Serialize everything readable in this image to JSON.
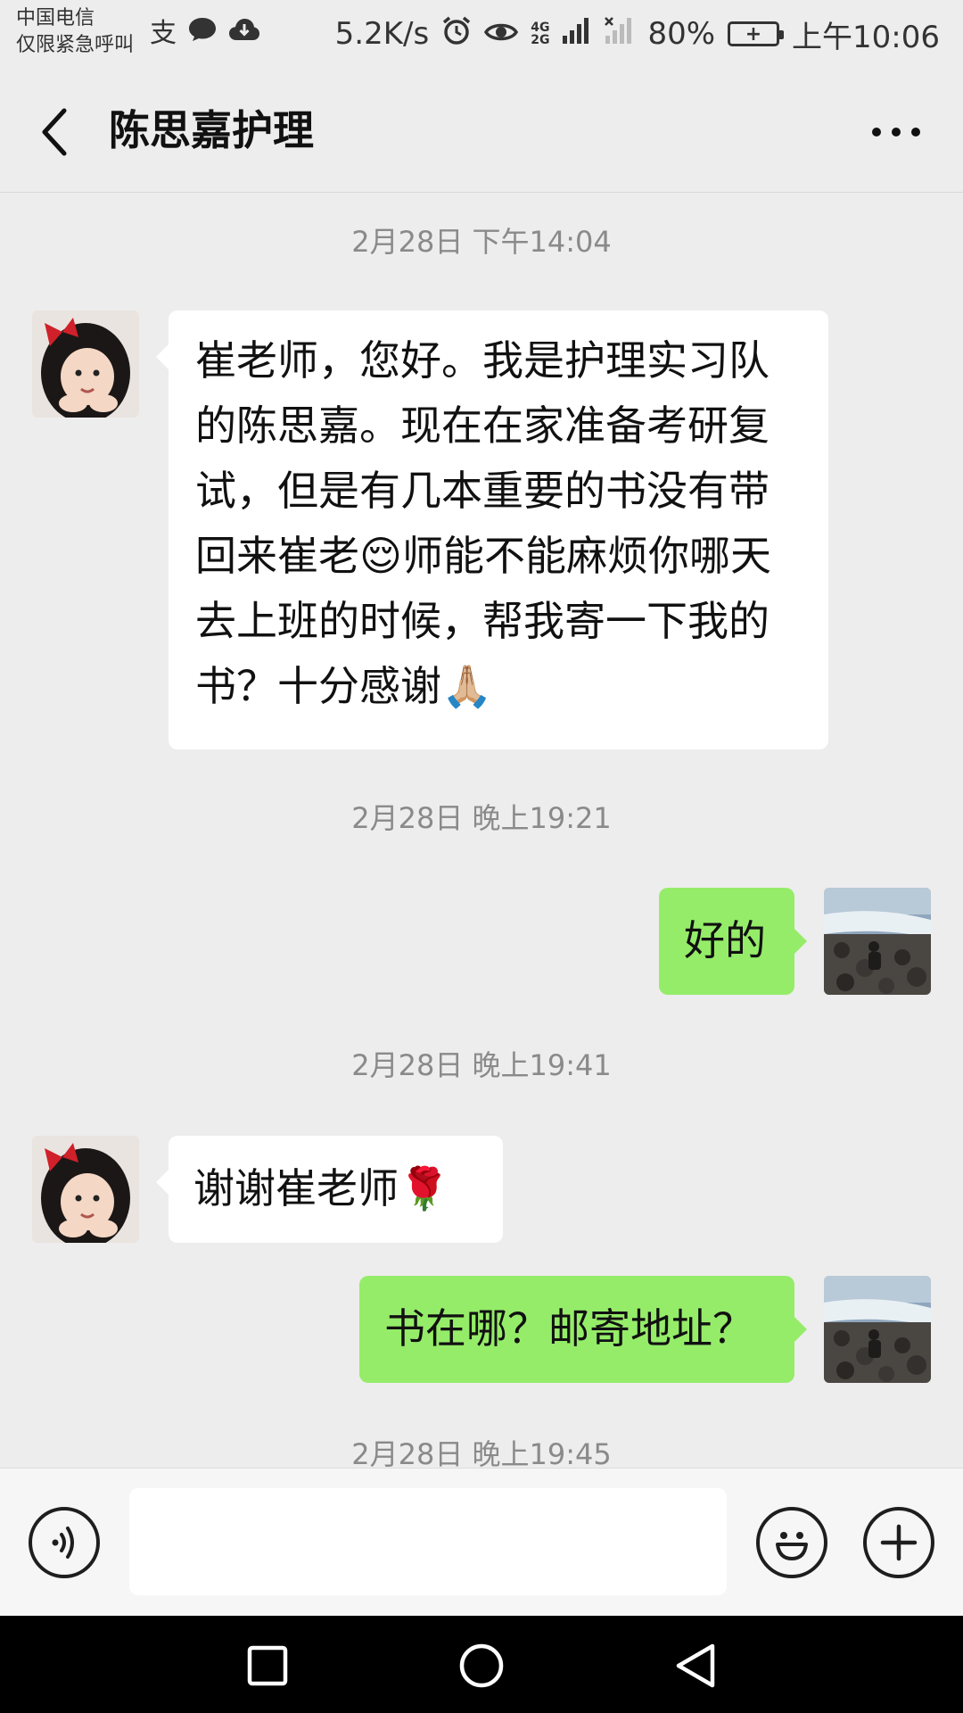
{
  "status_bar": {
    "carrier_line1": "中国电信",
    "carrier_line2": "仅限紧急呼叫",
    "net_speed": "5.2K/s",
    "signal_label_top": "4G",
    "signal_label_bottom": "2G",
    "battery": "80%",
    "time": "上午10:06"
  },
  "header": {
    "title": "陈思嘉护理",
    "back_icon": "chevron-left-icon",
    "more_icon": "more-dots-icon"
  },
  "messages": [
    {
      "type": "timestamp",
      "text": "2月28日 下午14:04"
    },
    {
      "type": "message",
      "side": "left",
      "text": "崔老师，您好。我是护理实习队的陈思嘉。现在在家准备考研复试，但是有几本重要的书没有带回来崔老😌师能不能麻烦你哪天去上班的时候，帮我寄一下我的书？十分感谢🙏🏼"
    },
    {
      "type": "timestamp",
      "text": "2月28日 晚上19:21"
    },
    {
      "type": "message",
      "side": "right",
      "text": "好的"
    },
    {
      "type": "timestamp",
      "text": "2月28日 晚上19:41"
    },
    {
      "type": "message",
      "side": "left",
      "text": "谢谢崔老师🌹"
    },
    {
      "type": "message",
      "side": "right",
      "text": "书在哪？邮寄地址？"
    },
    {
      "type": "timestamp",
      "text": "2月28日 晚上19:45"
    }
  ],
  "input_bar": {
    "voice_icon": "voice-icon",
    "input_value": "",
    "emoji_icon": "emoji-icon",
    "plus_icon": "plus-icon"
  },
  "nav_bar": {
    "recent_icon": "square-icon",
    "home_icon": "circle-icon",
    "back_icon": "triangle-back-icon"
  },
  "colors": {
    "background": "#ededed",
    "bubble_self": "#95ec69",
    "bubble_other": "#ffffff"
  }
}
